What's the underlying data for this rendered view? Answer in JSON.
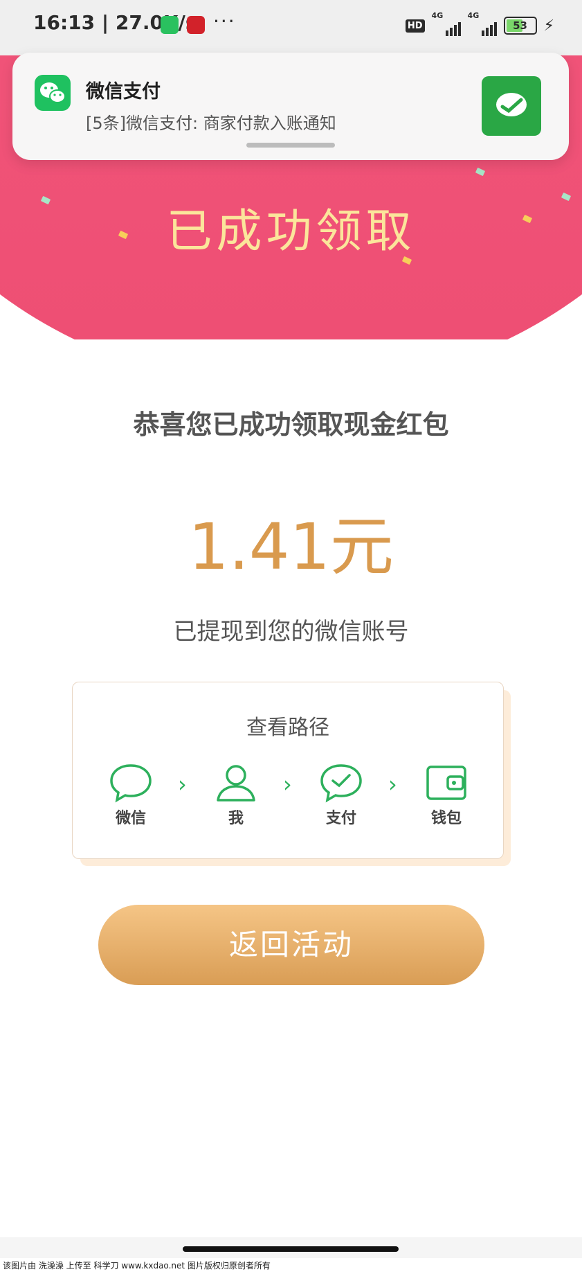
{
  "status_bar": {
    "time": "16:13 | 27.0K/s",
    "more": "···",
    "hd": "HD",
    "net1": "4G",
    "net2": "4G",
    "battery": "53"
  },
  "notification": {
    "app_name": "微信支付",
    "message": "[5条]微信支付: 商家付款入账通知"
  },
  "hero": {
    "title": "已成功领取"
  },
  "main": {
    "congrats": "恭喜您已成功领取现金红包",
    "amount": "1.41元",
    "withdraw": "已提现到您的微信账号"
  },
  "path_card": {
    "title": "查看路径",
    "steps": [
      {
        "label": "微信",
        "icon": "chat-bubble-icon"
      },
      {
        "label": "我",
        "icon": "user-icon"
      },
      {
        "label": "支付",
        "icon": "pay-check-icon"
      },
      {
        "label": "钱包",
        "icon": "wallet-icon"
      }
    ],
    "arrow": "›"
  },
  "actions": {
    "back": "返回活动"
  },
  "watermark": "该图片由 洗澡澡 上传至 科学刀 www.kxdao.net 图片版权归原创者所有",
  "colors": {
    "hero_pink": "#f05378",
    "accent_gold": "#d99a4e",
    "wechat_green": "#2db05c"
  }
}
